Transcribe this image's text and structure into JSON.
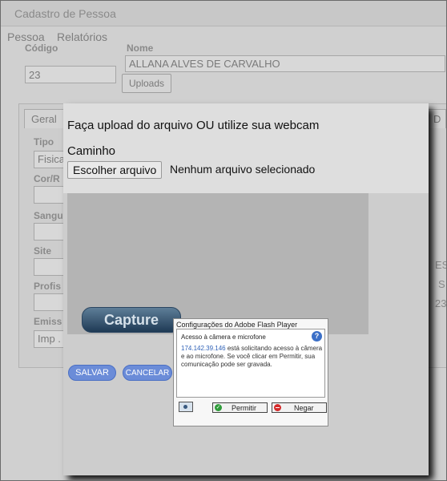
{
  "window": {
    "title": "Cadastro de Pessoa"
  },
  "menu": {
    "items": [
      "Pessoa",
      "Relatórios"
    ]
  },
  "form": {
    "codigo_label": "Código",
    "codigo_value": "23",
    "nome_label": "Nome",
    "nome_value": "ALLANA ALVES DE CARVALHO",
    "uploads_label": "Uploads"
  },
  "tabs": {
    "geral": "Geral",
    "right_tab": "D"
  },
  "side_fields": {
    "tipo_label": "Tipo",
    "tipo_value": "Fisica",
    "cor_label": "Cor/R",
    "sangue_label": "Sangu",
    "site_label": "Site",
    "profissao_label": "Profis",
    "emissor_label": "Emiss",
    "emissor_value": "Imp ."
  },
  "right_fragments": {
    "a": "ES",
    "b": "S",
    "c": "23"
  },
  "modal": {
    "heading": "Faça upload do arquivo OU utilize sua webcam",
    "caminho_label": "Caminho",
    "file_button": "Escolher arquivo",
    "file_status": "Nenhum arquivo selecionado",
    "capture_label": "Capture",
    "save_label": "SALVAR",
    "cancel_label": "CANCELAR"
  },
  "flash_dialog": {
    "title": "Configurações do Adobe Flash Player",
    "heading": "Acesso à câmera e microfone",
    "help": "?",
    "ip": "174.142.39.146",
    "message": " está solicitando acesso à câmera e ao microfone. Se você clicar em Permitir, sua comunicação pode ser gravada.",
    "allow_label": "Permitir",
    "deny_label": "Negar"
  }
}
